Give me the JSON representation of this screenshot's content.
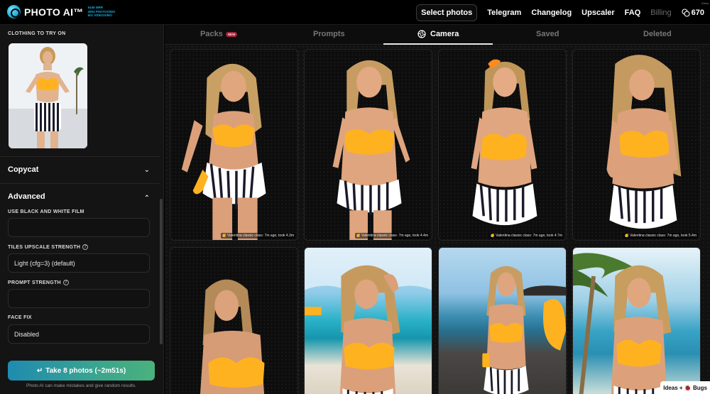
{
  "app": {
    "name": "PHOTO AI™",
    "stats": [
      "5436 MRR",
      "4904 PHOTOS/MO",
      "601 VIDEOS/MO"
    ],
    "corner_badge": "63ms"
  },
  "topnav": {
    "select_photos": "Select photos",
    "links": [
      "Telegram",
      "Changelog",
      "Upscaler",
      "FAQ"
    ],
    "billing": "Billing",
    "credits": "670"
  },
  "sidebar": {
    "clothing_label": "CLOTHING TO TRY ON",
    "copycat_title": "Copycat",
    "advanced_title": "Advanced",
    "fields": [
      {
        "label": "USE BLACK AND WHITE FILM",
        "value": ""
      },
      {
        "label": "TILES UPSCALE STRENGTH",
        "value": "Light (cfg=3) (default)"
      },
      {
        "label": "PROMPT STRENGTH",
        "value": ""
      },
      {
        "label": "FACE FIX",
        "value": "Disabled"
      }
    ],
    "take_button": "Take 8 photos (~2m51s)",
    "disclaimer": "Photo AI can make mistakes and give random results."
  },
  "tabs": [
    {
      "label": "Packs",
      "badge": "NEW"
    },
    {
      "label": "Prompts"
    },
    {
      "label": "Camera",
      "active": true
    },
    {
      "label": "Saved"
    },
    {
      "label": "Deleted"
    }
  ],
  "gallery": {
    "captions": [
      "🥳 Valentina classic class: 7m ago, took 4.3m",
      "🥳 Valentina classic class: 7m ago, took 4.4m",
      "🥳 Valentina classic class: 7m ago, took 4.7m",
      "🥳 Valentina classic class: 7m ago, took 5.4m"
    ]
  },
  "widget": {
    "ideas_label": "Ideas + 🐞 Bugs"
  },
  "colors": {
    "accent_start": "#1f8bb0",
    "accent_end": "#4bb17d",
    "bikini_top": "#ffb21f",
    "new_badge": "#a3243a"
  }
}
